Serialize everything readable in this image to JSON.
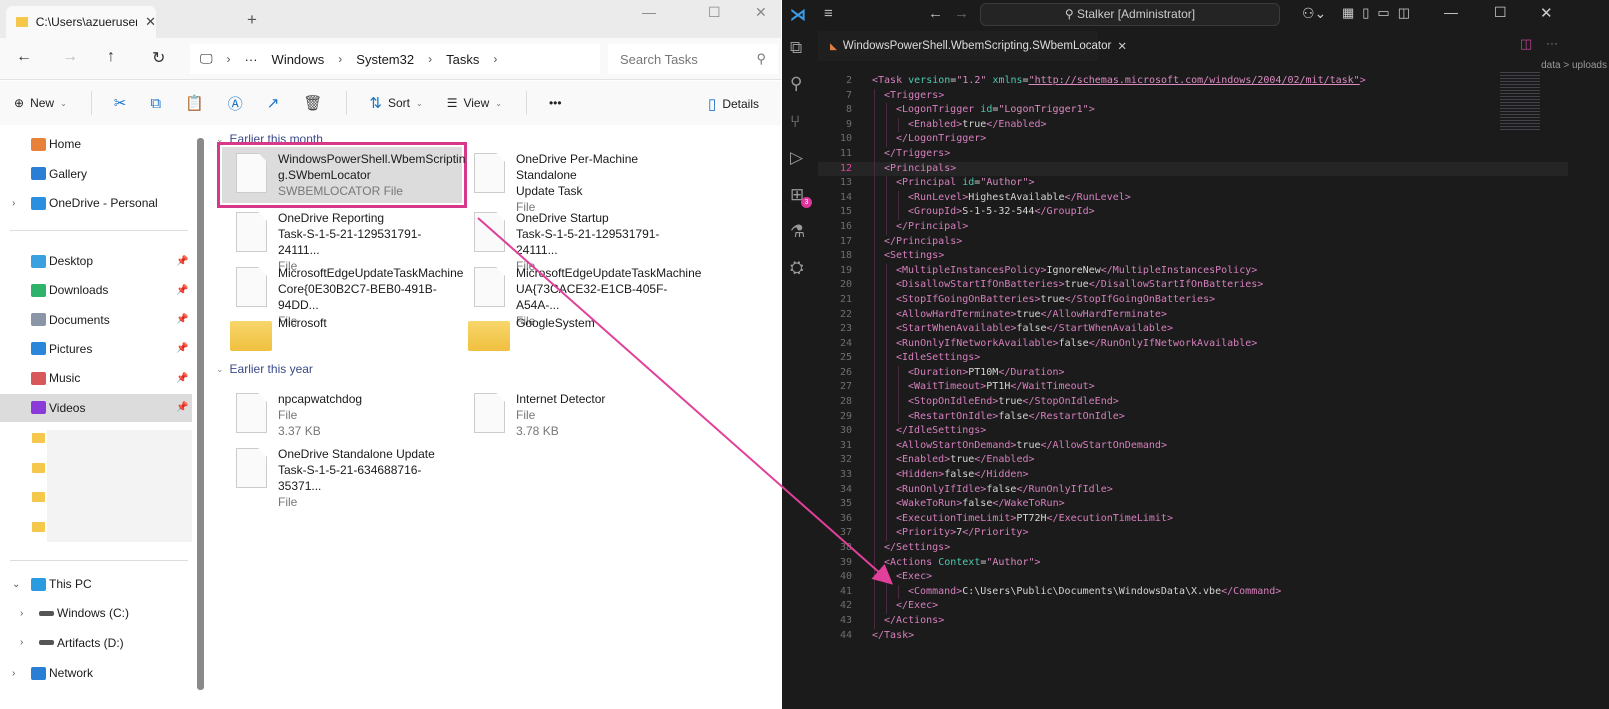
{
  "explorer": {
    "tab_title": "C:\\Users\\azueruser\\Downloads",
    "breadcrumb": [
      "Windows",
      "System32",
      "Tasks"
    ],
    "search_placeholder": "Search Tasks",
    "toolbar": {
      "new": "New",
      "sort": "Sort",
      "view": "View",
      "more": "•••",
      "details": "Details"
    },
    "sidebar": {
      "quick": [
        {
          "label": "Home",
          "color": "#e8823a"
        },
        {
          "label": "Gallery",
          "color": "#2a7fd4"
        },
        {
          "label": "OneDrive - Personal",
          "color": "#2b8fe0"
        }
      ],
      "pinned": [
        {
          "label": "Desktop",
          "color": "#3aa0e0"
        },
        {
          "label": "Downloads",
          "color": "#2fb36a"
        },
        {
          "label": "Documents",
          "color": "#8a96a8"
        },
        {
          "label": "Pictures",
          "color": "#2a86d8"
        },
        {
          "label": "Music",
          "color": "#d8585a"
        },
        {
          "label": "Videos",
          "color": "#8a3ad8"
        }
      ],
      "this_pc": "This PC",
      "drives": [
        "Windows (C:)",
        "Artifacts (D:)"
      ],
      "network": "Network"
    },
    "groups": [
      {
        "label": "Earlier this month",
        "items": [
          {
            "name": "WindowsPowerShell.WbemScriptin g.SWbemLocator",
            "line1": "WindowsPowerShell.WbemScriptin",
            "line2": "g.SWbemLocator",
            "type": "SWBEMLOCATOR File",
            "kind": "file",
            "selected": true
          },
          {
            "line1": "OneDrive Per-Machine Standalone",
            "line2": "Update Task",
            "type": "File",
            "kind": "file"
          },
          {
            "line1": "OneDrive Reporting",
            "line2": "Task-S-1-5-21-129531791-24111...",
            "type": "File",
            "kind": "file"
          },
          {
            "line1": "OneDrive Startup",
            "line2": "Task-S-1-5-21-129531791-24111...",
            "type": "File",
            "kind": "file"
          },
          {
            "line1": "MicrosoftEdgeUpdateTaskMachine",
            "line2": "Core{0E30B2C7-BEB0-491B-94DD...",
            "type": "File",
            "kind": "file"
          },
          {
            "line1": "MicrosoftEdgeUpdateTaskMachine",
            "line2": "UA{73CACE32-E1CB-405F-A54A-...",
            "type": "File",
            "kind": "file"
          },
          {
            "line1": "Microsoft",
            "kind": "folder"
          },
          {
            "line1": "GoogleSystem",
            "kind": "folder"
          }
        ]
      },
      {
        "label": "Earlier this year",
        "items": [
          {
            "line1": "npcapwatchdog",
            "line2": "File",
            "type": "3.37 KB",
            "kind": "file"
          },
          {
            "line1": "Internet Detector",
            "line2": "File",
            "type": "3.78 KB",
            "kind": "file"
          },
          {
            "line1": "OneDrive Standalone Update",
            "line2": "Task-S-1-5-21-634688716-35371...",
            "type": "File",
            "kind": "file"
          }
        ]
      }
    ]
  },
  "vscode": {
    "command_center": "Stalker [Administrator]",
    "tab": "WindowsPowerShell.WbemScripting.SWbemLocator",
    "breadcrumb": "data > uploads",
    "extensions_badge": "3",
    "highlight_line": 12,
    "lines": [
      {
        "n": 2,
        "i": 0,
        "c": "<Task version=\"1.2\" xmlns=\"http://schemas.microsoft.com/windows/2004/02/mit/task\">"
      },
      {
        "n": 7,
        "i": 1,
        "c": "<Triggers>"
      },
      {
        "n": 8,
        "i": 2,
        "c": "<LogonTrigger id=\"LogonTrigger1\">"
      },
      {
        "n": 9,
        "i": 3,
        "c": "<Enabled>true</Enabled>"
      },
      {
        "n": 10,
        "i": 2,
        "c": "</LogonTrigger>"
      },
      {
        "n": 11,
        "i": 1,
        "c": "</Triggers>"
      },
      {
        "n": 12,
        "i": 1,
        "c": "<Principals>"
      },
      {
        "n": 13,
        "i": 2,
        "c": "<Principal id=\"Author\">"
      },
      {
        "n": 14,
        "i": 3,
        "c": "<RunLevel>HighestAvailable</RunLevel>"
      },
      {
        "n": 15,
        "i": 3,
        "c": "<GroupId>S-1-5-32-544</GroupId>"
      },
      {
        "n": 16,
        "i": 2,
        "c": "</Principal>"
      },
      {
        "n": 17,
        "i": 1,
        "c": "</Principals>"
      },
      {
        "n": 18,
        "i": 1,
        "c": "<Settings>"
      },
      {
        "n": 19,
        "i": 2,
        "c": "<MultipleInstancesPolicy>IgnoreNew</MultipleInstancesPolicy>"
      },
      {
        "n": 20,
        "i": 2,
        "c": "<DisallowStartIfOnBatteries>true</DisallowStartIfOnBatteries>"
      },
      {
        "n": 21,
        "i": 2,
        "c": "<StopIfGoingOnBatteries>true</StopIfGoingOnBatteries>"
      },
      {
        "n": 22,
        "i": 2,
        "c": "<AllowHardTerminate>true</AllowHardTerminate>"
      },
      {
        "n": 23,
        "i": 2,
        "c": "<StartWhenAvailable>false</StartWhenAvailable>"
      },
      {
        "n": 24,
        "i": 2,
        "c": "<RunOnlyIfNetworkAvailable>false</RunOnlyIfNetworkAvailable>"
      },
      {
        "n": 25,
        "i": 2,
        "c": "<IdleSettings>"
      },
      {
        "n": 26,
        "i": 3,
        "c": "<Duration>PT10M</Duration>"
      },
      {
        "n": 27,
        "i": 3,
        "c": "<WaitTimeout>PT1H</WaitTimeout>"
      },
      {
        "n": 28,
        "i": 3,
        "c": "<StopOnIdleEnd>true</StopOnIdleEnd>"
      },
      {
        "n": 29,
        "i": 3,
        "c": "<RestartOnIdle>false</RestartOnIdle>"
      },
      {
        "n": 30,
        "i": 2,
        "c": "</IdleSettings>"
      },
      {
        "n": 31,
        "i": 2,
        "c": "<AllowStartOnDemand>true</AllowStartOnDemand>"
      },
      {
        "n": 32,
        "i": 2,
        "c": "<Enabled>true</Enabled>"
      },
      {
        "n": 33,
        "i": 2,
        "c": "<Hidden>false</Hidden>"
      },
      {
        "n": 34,
        "i": 2,
        "c": "<RunOnlyIfIdle>false</RunOnlyIfIdle>"
      },
      {
        "n": 35,
        "i": 2,
        "c": "<WakeToRun>false</WakeToRun>"
      },
      {
        "n": 36,
        "i": 2,
        "c": "<ExecutionTimeLimit>PT72H</ExecutionTimeLimit>"
      },
      {
        "n": 37,
        "i": 2,
        "c": "<Priority>7</Priority>"
      },
      {
        "n": 38,
        "i": 1,
        "c": "</Settings>"
      },
      {
        "n": 39,
        "i": 1,
        "c": "<Actions Context=\"Author\">"
      },
      {
        "n": 40,
        "i": 2,
        "c": "<Exec>"
      },
      {
        "n": 41,
        "i": 3,
        "c": "<Command>C:\\Users\\Public\\Documents\\WindowsData\\X.vbe</Command>"
      },
      {
        "n": 42,
        "i": 2,
        "c": "</Exec>"
      },
      {
        "n": 43,
        "i": 1,
        "c": "</Actions>"
      },
      {
        "n": 44,
        "i": 0,
        "c": "</Task>"
      }
    ]
  },
  "annotation_color": "#e0409a"
}
